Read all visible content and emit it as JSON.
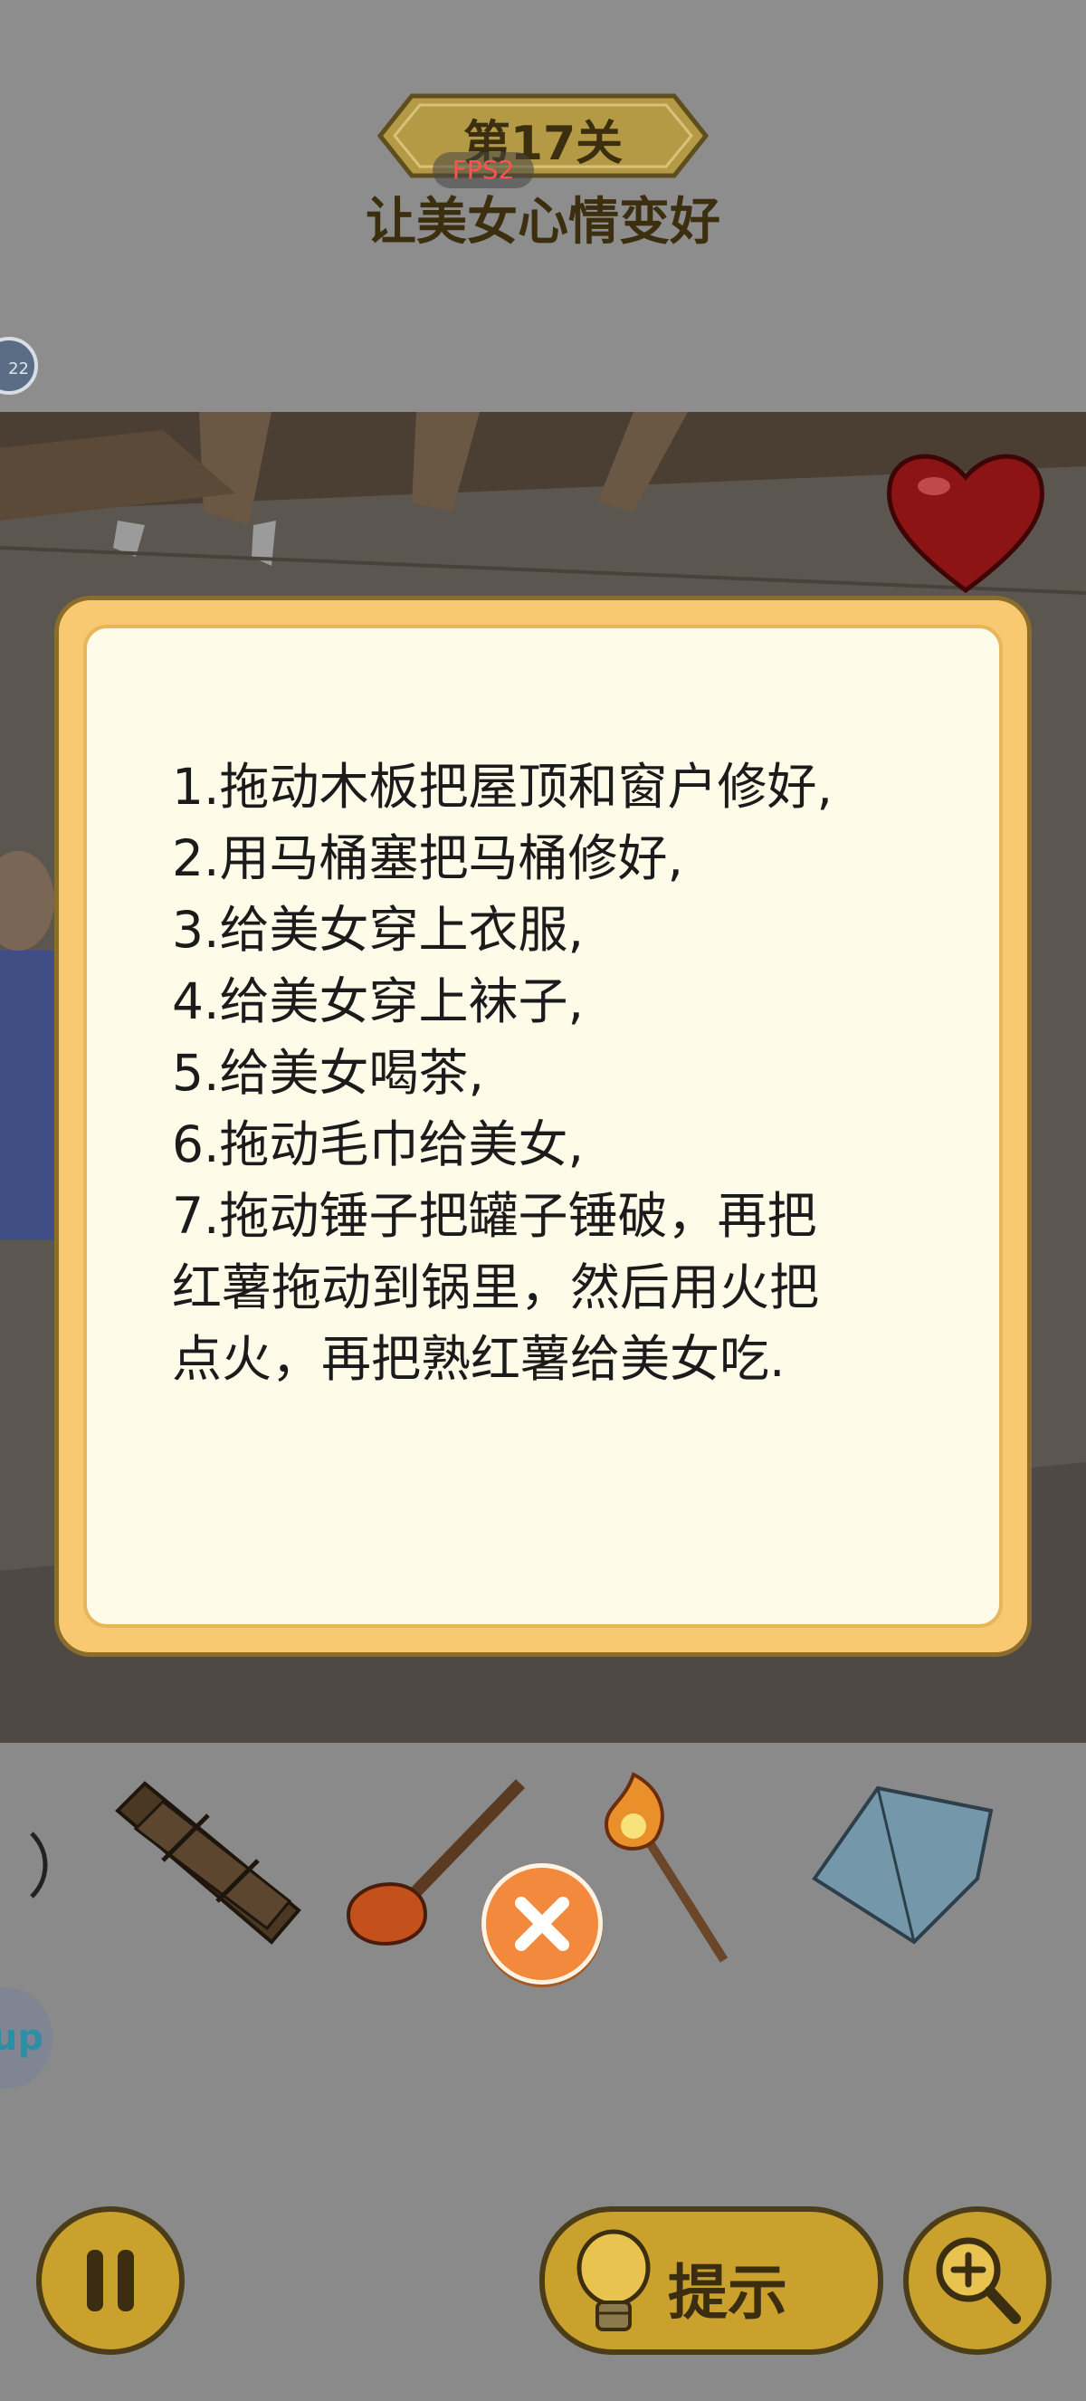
{
  "level": {
    "title": "第17关",
    "subtitle": "让美女心情变好"
  },
  "overlay": {
    "fps": "FPS2",
    "side_bubble_text": "22",
    "side_bubble_2_text": "up"
  },
  "hint_dialog": {
    "lines": [
      "1.拖动木板把屋顶和窗户修好,",
      "2.用马桶塞把马桶修好,",
      "3.给美女穿上衣服,",
      "4.给美女穿上袜子,",
      "5.给美女喝茶,",
      "6.拖动毛巾给美女,",
      "7.拖动锤子把罐子锤破，再把",
      "红薯拖动到锅里，然后用火把",
      "点火，再把熟红薯给美女吃."
    ]
  },
  "items": [
    "planks-icon",
    "plunger-icon",
    "torch-icon",
    "towel-icon"
  ],
  "controls": {
    "hint_label": "提示",
    "pause": "pause-icon",
    "zoom": "zoom-in-icon"
  },
  "colors": {
    "dialog_border": "#f8c970",
    "dialog_fill": "#fffbe9",
    "close_button": "#f2893c",
    "gold_button": "#caa12d"
  }
}
